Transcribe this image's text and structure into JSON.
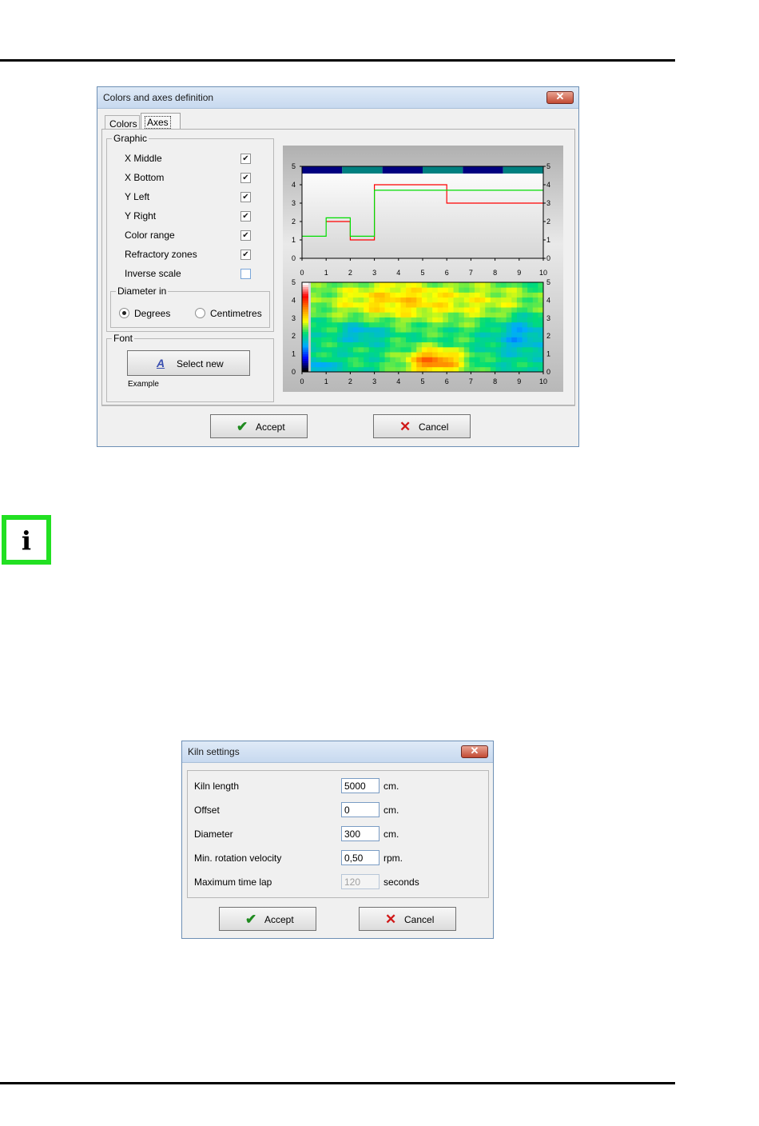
{
  "colors_dialog": {
    "title": "Colors and axes definition",
    "close_symbol": "✕",
    "tabs": [
      {
        "label": "Colors"
      },
      {
        "label": "Axes"
      }
    ],
    "graphic_group": {
      "label": "Graphic",
      "options": [
        {
          "label": "X Middle",
          "checked": true
        },
        {
          "label": "X Bottom",
          "checked": true
        },
        {
          "label": "Y Left",
          "checked": true
        },
        {
          "label": "Y Right",
          "checked": true
        },
        {
          "label": "Color range",
          "checked": true
        },
        {
          "label": "Refractory zones",
          "checked": true
        },
        {
          "label": "Inverse scale",
          "checked": false
        }
      ]
    },
    "diameter_group": {
      "label": "Diameter in",
      "options": [
        {
          "label": "Degrees",
          "selected": true
        },
        {
          "label": "Centimetres",
          "selected": false
        }
      ]
    },
    "font_group": {
      "label": "Font",
      "select_button": "Select new",
      "example_label": "Example"
    },
    "accept_label": "Accept",
    "cancel_label": "Cancel",
    "check_mark": "✔",
    "accept_icon": "✔",
    "cancel_icon": "✕"
  },
  "info_icon": {
    "glyph": "i",
    "color": "#22e022"
  },
  "kiln_dialog": {
    "title": "Kiln settings",
    "close_symbol": "✕",
    "fields": [
      {
        "label": "Kiln length",
        "value": "5000",
        "unit": "cm.",
        "disabled": false
      },
      {
        "label": "Offset",
        "value": "0",
        "unit": "cm.",
        "disabled": false
      },
      {
        "label": "Diameter",
        "value": "300",
        "unit": "cm.",
        "disabled": false
      },
      {
        "label": "Min. rotation velocity",
        "value": "0,50",
        "unit": "rpm.",
        "disabled": false
      },
      {
        "label": "Maximum time lap",
        "value": "120",
        "unit": "seconds",
        "disabled": true
      }
    ],
    "accept_label": "Accept",
    "cancel_label": "Cancel",
    "accept_icon": "✔",
    "cancel_icon": "✕"
  },
  "chart_data": [
    {
      "type": "line",
      "x_ticks": [
        "0",
        "1",
        "2",
        "3",
        "4",
        "5",
        "6",
        "7",
        "8",
        "9",
        "10"
      ],
      "y_ticks": [
        "0",
        "1",
        "2",
        "3",
        "4",
        "5"
      ],
      "xlim": [
        0,
        10
      ],
      "ylim": [
        0,
        5
      ],
      "zone_band_colors": [
        "#000080",
        "#008080"
      ],
      "series": [
        {
          "color": "#ff0000",
          "points": [
            [
              1,
              2
            ],
            [
              2,
              2
            ],
            [
              2,
              1
            ],
            [
              3,
              1
            ],
            [
              3,
              4
            ],
            [
              6,
              4
            ],
            [
              6,
              3
            ],
            [
              10,
              3
            ]
          ]
        },
        {
          "color": "#00dd00",
          "points": [
            [
              0,
              1.2
            ],
            [
              1,
              1.2
            ],
            [
              1,
              2.2
            ],
            [
              2,
              2.2
            ],
            [
              2,
              1.2
            ],
            [
              3,
              1.2
            ],
            [
              3,
              3.7
            ],
            [
              10,
              3.7
            ]
          ]
        }
      ]
    },
    {
      "type": "heatmap",
      "x_ticks": [
        "0",
        "1",
        "2",
        "3",
        "4",
        "5",
        "6",
        "7",
        "8",
        "9",
        "10"
      ],
      "y_ticks": [
        "0",
        "1",
        "2",
        "3",
        "4",
        "5"
      ],
      "xlim": [
        0,
        10
      ],
      "ylim": [
        0,
        5
      ],
      "color_scale": [
        "#000000",
        "#0000ff",
        "#00aaff",
        "#00dd77",
        "#ffff00",
        "#ff8800",
        "#ff0000",
        "#ffffff"
      ]
    }
  ]
}
